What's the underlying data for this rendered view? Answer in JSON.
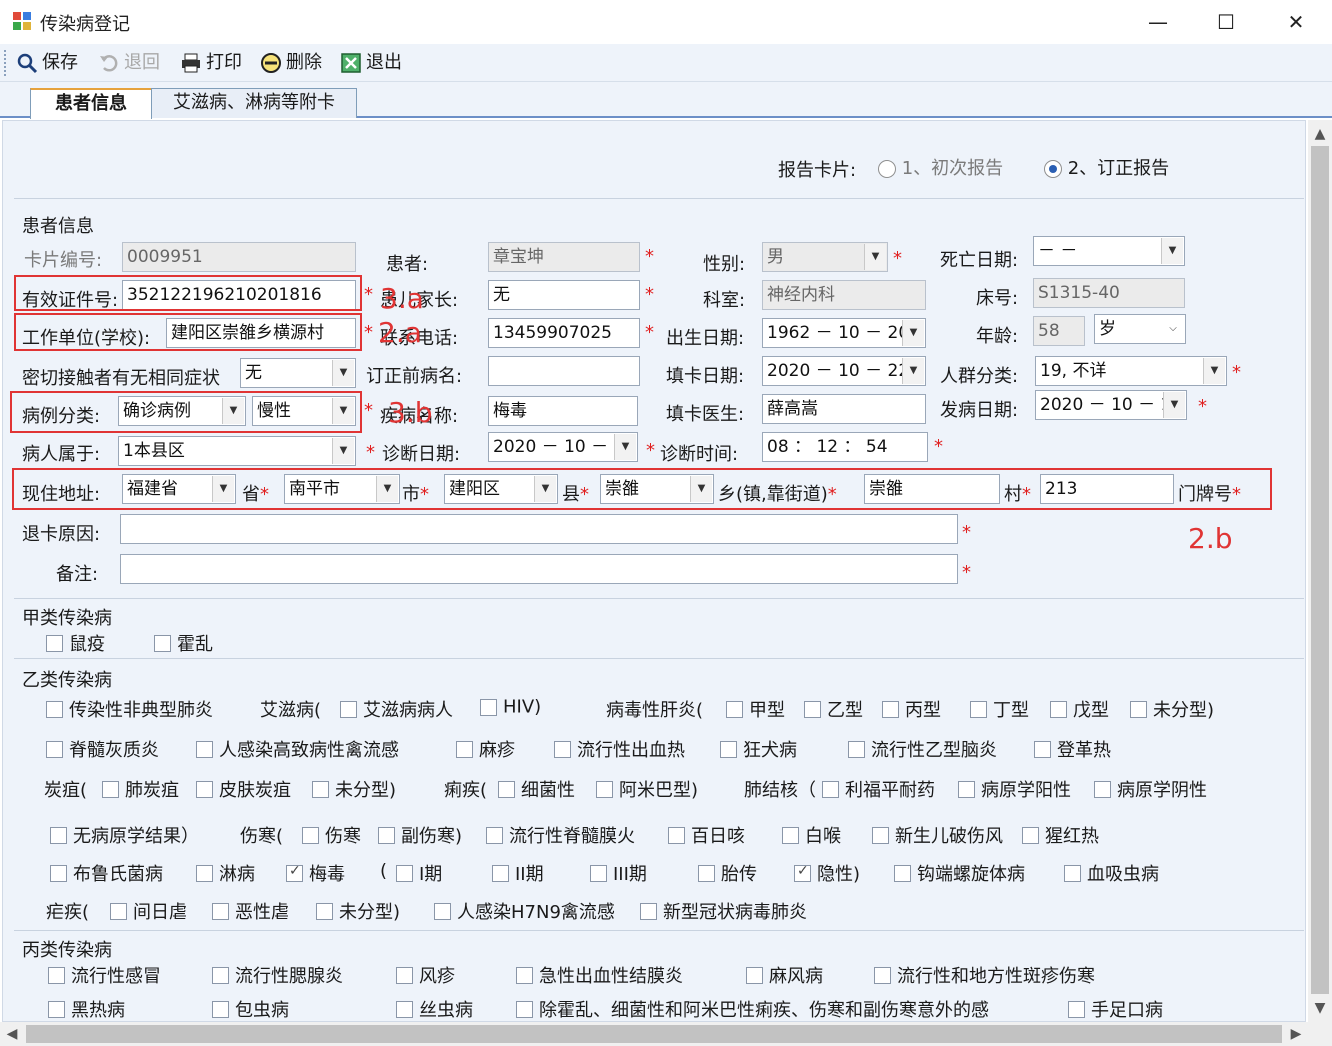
{
  "window": {
    "title": "传染病登记",
    "minimize": "—",
    "maximize": "☐",
    "close": "✕"
  },
  "toolbar": {
    "save": "保存",
    "undo": "退回",
    "print": "打印",
    "delete": "删除",
    "exit": "退出"
  },
  "tabs": [
    "患者信息",
    "艾滋病、淋病等附卡"
  ],
  "report": {
    "label": "报告卡片:",
    "opt1": "1、初次报告",
    "opt2": "2、订正报告",
    "selected": "2"
  },
  "patient": {
    "group": "患者信息",
    "card_no_label": "卡片编号:",
    "card_no": "0009951",
    "name_label": "患者:",
    "name": "章宝坤",
    "sex_label": "性别:",
    "sex": "男",
    "death_label": "死亡日期:",
    "death": "－  －",
    "id_label": "有效证件号:",
    "id": "352122196210201816",
    "parent_label": "患儿家长:",
    "parent": "无",
    "dept_label": "科室:",
    "dept": "神经内科",
    "bed_label": "床号:",
    "bed": "S1315-40",
    "work_label": "工作单位(学校):",
    "work": "建阳区崇雒乡横源村",
    "phone_label": "联系电话:",
    "phone": "13459907025",
    "birth_label": "出生日期:",
    "birth": "1962 － 10 － 20",
    "age_label": "年龄:",
    "age": "58",
    "age_unit": "岁",
    "contact_label": "密切接触者有无相同症状",
    "contact": "无",
    "prev_label": "订正前病名:",
    "prev": "",
    "fill_date_label": "填卡日期:",
    "fill_date": "2020 － 10 － 22",
    "crowd_label": "人群分类:",
    "crowd": "19, 不详",
    "case_label": "病例分类:",
    "case1": "确诊病例",
    "case2": "慢性",
    "disease_label": "疾病名称:",
    "disease": "梅毒",
    "doctor_label": "填卡医生:",
    "doctor": "薛高嵩",
    "onset_label": "发病日期:",
    "onset": "2020 － 10 － 13",
    "belong_label": "病人属于:",
    "belong": "1本县区",
    "diag_date_label": "诊断日期:",
    "diag_date": "2020 － 10 － 13",
    "diag_time_label": "诊断时间:",
    "diag_time": "08 ： 12 ： 54",
    "addr_label": "现住地址:",
    "province": "福建省",
    "province_unit": "省",
    "city": "南平市",
    "city_unit": "市",
    "county": "建阳区",
    "county_unit": "县",
    "town": "崇雒",
    "town_unit": "乡(镇,靠街道)",
    "village": "崇雒",
    "village_unit": "村",
    "house": "213",
    "house_unit": "门牌号",
    "return_label": "退卡原因:",
    "remark_label": "备注:"
  },
  "annotations": [
    "3.a",
    "2.a",
    "3.b",
    "2.b"
  ],
  "groups": {
    "a": {
      "title": "甲类传染病",
      "items": [
        "鼠疫",
        "霍乱"
      ]
    },
    "b": {
      "title": "乙类传染病",
      "row1": [
        "传染性非典型肺炎",
        "艾滋病(",
        "艾滋病病人",
        "HIV)",
        "病毒性肝炎(",
        "甲型",
        "乙型",
        "丙型",
        "丁型",
        "戊型",
        "未分型)"
      ],
      "row2": [
        "脊髓灰质炎",
        "人感染高致病性禽流感",
        "麻疹",
        "流行性出血热",
        "狂犬病",
        "流行性乙型脑炎",
        "登革热"
      ],
      "row3": [
        "炭疽(",
        "肺炭疽",
        "皮肤炭疽",
        "未分型)",
        "痢疾(",
        "细菌性",
        "阿米巴型)",
        "肺结核（",
        "利福平耐药",
        "病原学阳性",
        "病原学阴性"
      ],
      "row4": [
        "无病原学结果）",
        "伤寒(",
        "伤寒",
        "副伤寒)",
        "流行性脊髓膜火",
        "百日咳",
        "白喉",
        "新生儿破伤风",
        "猩红热"
      ],
      "row5": [
        "布鲁氏菌病",
        "淋病",
        "梅毒",
        "(",
        "I期",
        "II期",
        "III期",
        "胎传",
        "隐性)",
        "钩端螺旋体病",
        "血吸虫病"
      ],
      "row6": [
        "疟疾(",
        "间日虐",
        "恶性虐",
        "未分型)",
        "人感染H7N9禽流感",
        "新型冠状病毒肺炎"
      ]
    },
    "c": {
      "title": "丙类传染病",
      "row1": [
        "流行性感冒",
        "流行性腮腺炎",
        "风疹",
        "急性出血性结膜炎",
        "麻风病",
        "流行性和地方性斑疹伤寒"
      ],
      "row2": [
        "黑热病",
        "包虫病",
        "丝虫病",
        "除霍乱、细菌性和阿米巴性痢疾、伤寒和副伤寒意外的感",
        "手足口病"
      ]
    }
  },
  "checked": [
    "梅毒",
    "隐性)"
  ]
}
